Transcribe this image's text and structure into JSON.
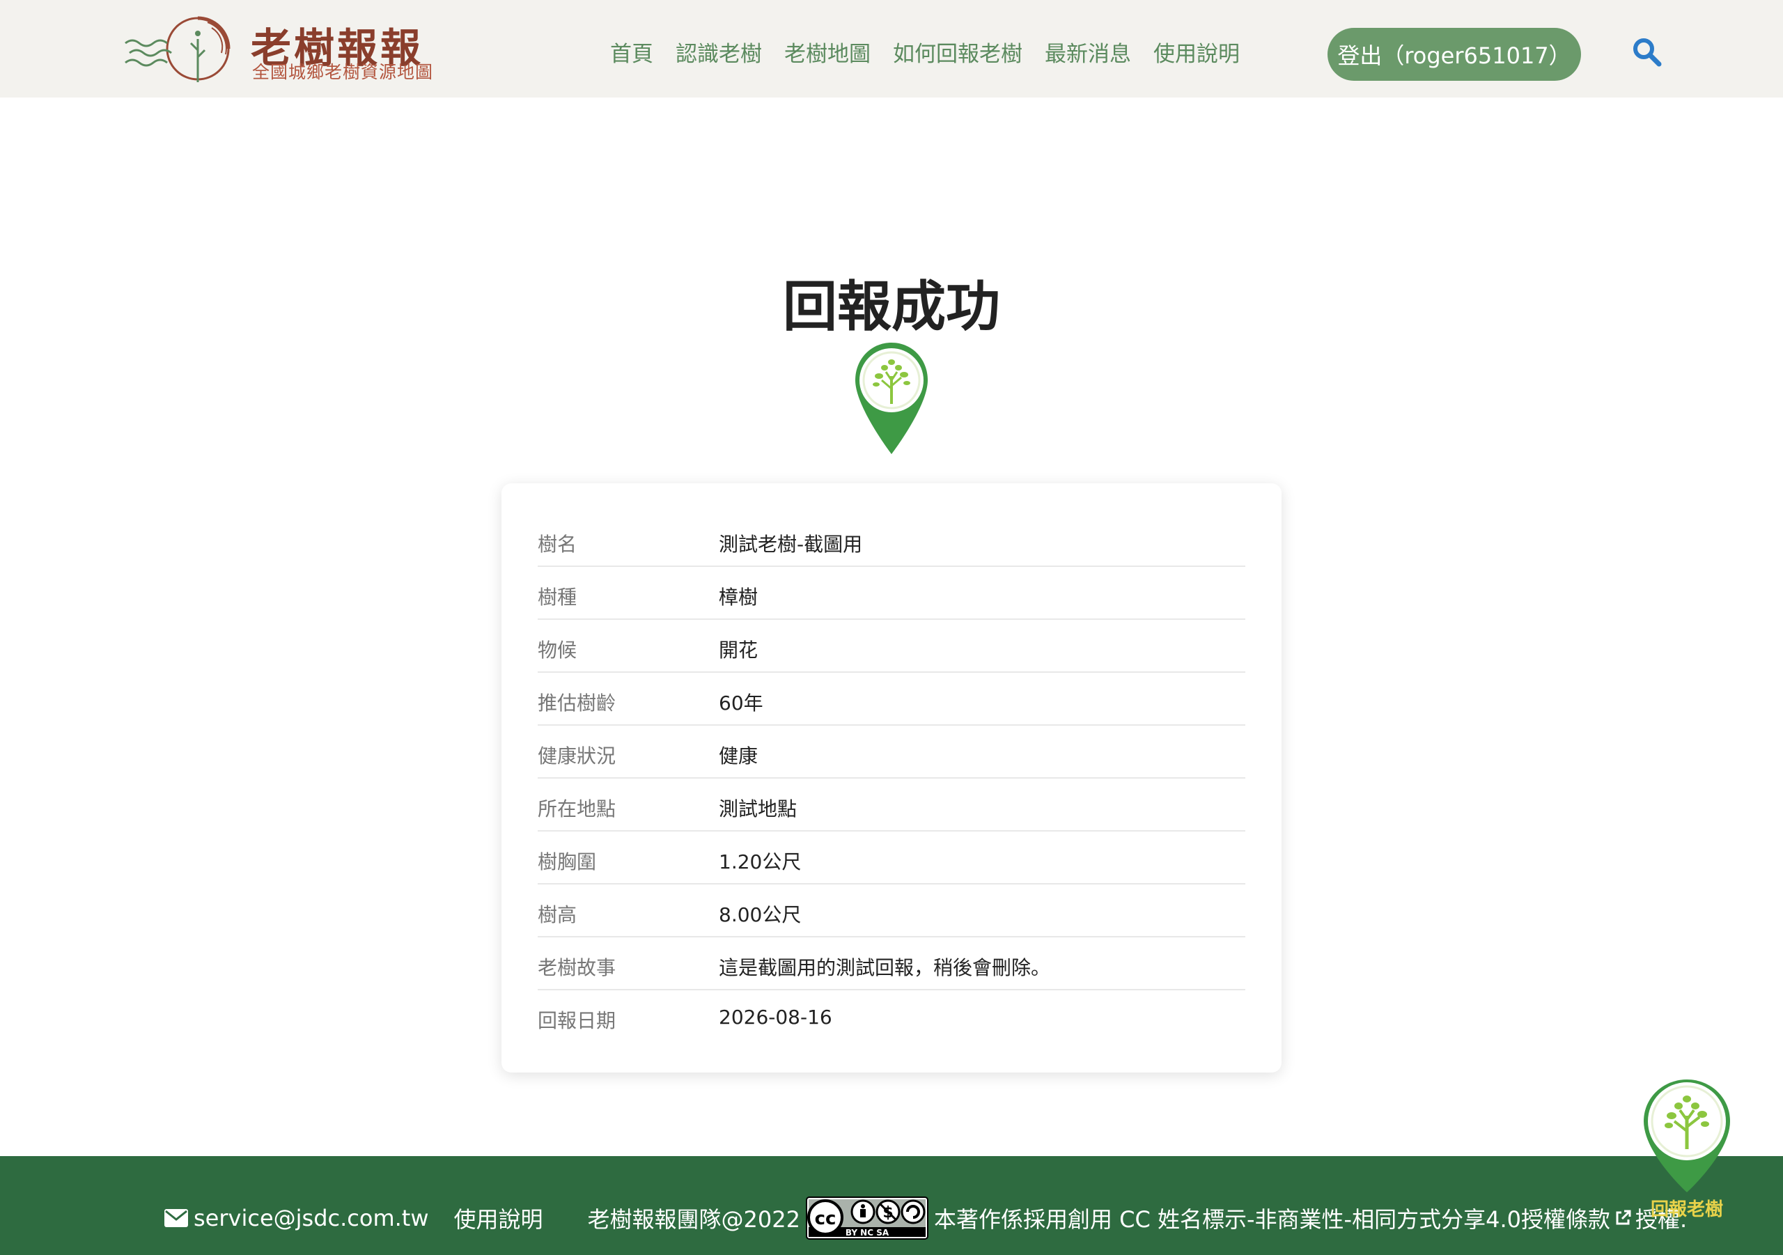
{
  "header": {
    "logo_title": "老樹報報",
    "logo_subtitle": "全國城鄉老樹資源地圖",
    "nav": [
      "首頁",
      "認識老樹",
      "老樹地圖",
      "如何回報老樹",
      "最新消息",
      "使用說明"
    ],
    "logout_label": "登出（roger651017）",
    "search_icon": "search-icon"
  },
  "main": {
    "title": "回報成功",
    "pin_icon": "tree-pin-icon",
    "details": [
      {
        "label": "樹名",
        "value": "測試老樹-截圖用"
      },
      {
        "label": "樹種",
        "value": "樟樹"
      },
      {
        "label": "物候",
        "value": "開花"
      },
      {
        "label": "推估樹齡",
        "value": "60年"
      },
      {
        "label": "健康狀況",
        "value": "健康"
      },
      {
        "label": "所在地點",
        "value": "測試地點"
      },
      {
        "label": "樹胸圍",
        "value": "1.20公尺"
      },
      {
        "label": "樹高",
        "value": "8.00公尺"
      },
      {
        "label": "老樹故事",
        "value": "這是截圖用的測試回報，稍後會刪除。"
      },
      {
        "label": "回報日期",
        "value": "2026-08-16"
      }
    ]
  },
  "float_button": {
    "label": "回報老樹",
    "icon": "tree-pin-icon"
  },
  "footer": {
    "email": "service@jsdc.com.tw",
    "help": "使用說明",
    "copyright": "老樹報報團隊@2022",
    "license_text": "本著作係採用創用 CC 姓名標示-非商業性-相同方式分享4.0授權條款",
    "license_suffix": "授權.",
    "cc_badge_text": "BY NC SA"
  },
  "colors": {
    "header_bg": "#f3f2ee",
    "nav_green": "#5b8a5e",
    "button_green": "#6b9a6b",
    "footer_green": "#2e6b40",
    "logo_brown": "#8a3e2c",
    "pin_green": "#3e9a45",
    "float_label": "#e8d24a"
  }
}
